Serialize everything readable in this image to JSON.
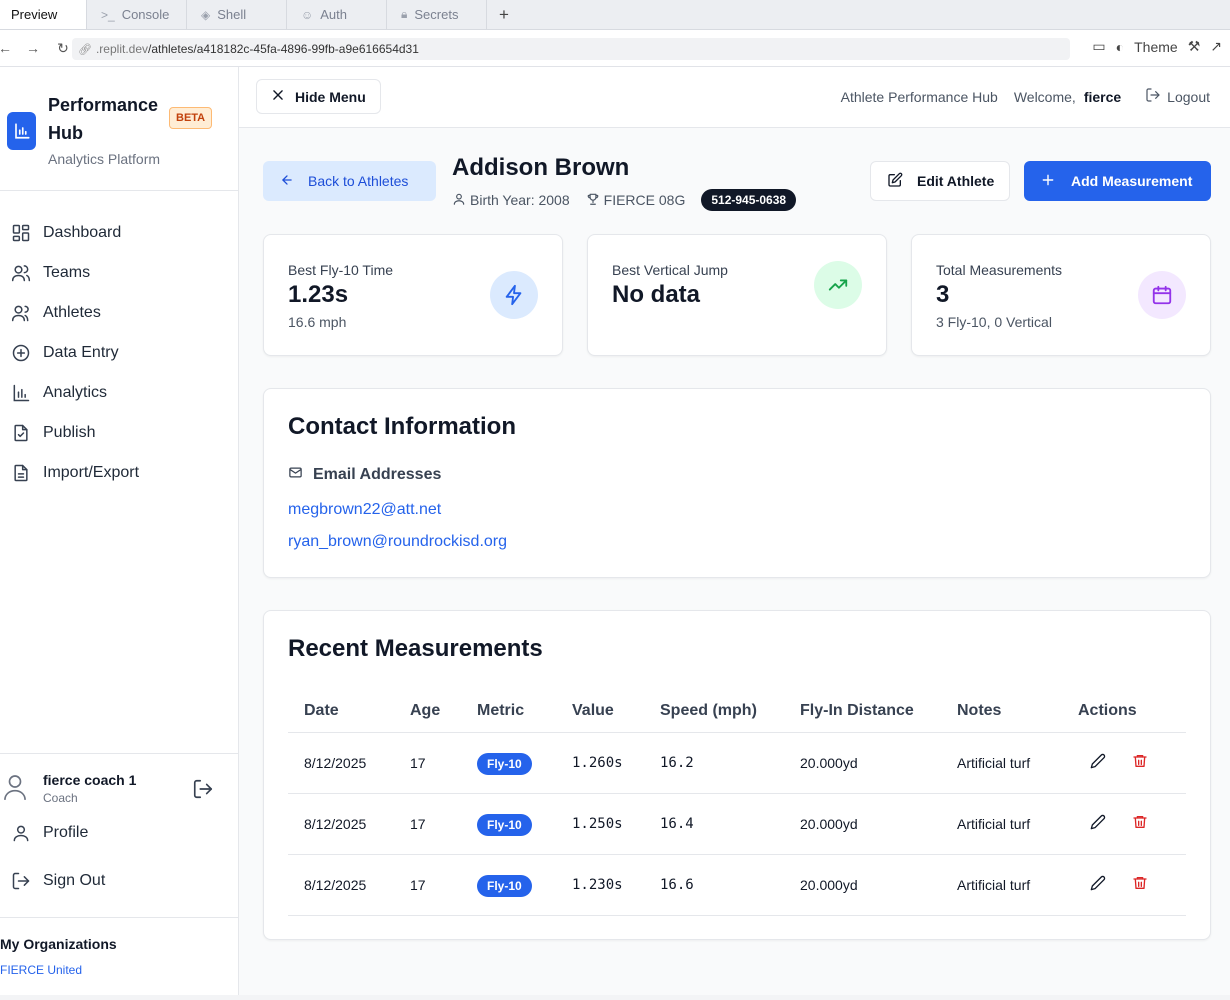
{
  "browser": {
    "tabs": [
      {
        "label": "Preview",
        "icon": "preview-icon",
        "active": true
      },
      {
        "label": "Console",
        "icon": "console-icon",
        "active": false
      },
      {
        "label": "Shell",
        "icon": "shell-icon",
        "active": false
      },
      {
        "label": "Auth",
        "icon": "auth-icon",
        "active": false
      },
      {
        "label": "Secrets",
        "icon": "lock-icon",
        "active": false
      }
    ],
    "url_dim": ".replit.dev",
    "url_path": "/athletes/a418182c-45fa-4896-99fb-a9e616654d31",
    "theme_label": "Theme"
  },
  "sidebar": {
    "brand_title": "Performance Hub",
    "brand_subtitle": "Analytics Platform",
    "beta_label": "BETA",
    "nav": [
      {
        "label": "Dashboard",
        "icon": "dashboard-icon"
      },
      {
        "label": "Teams",
        "icon": "teams-icon"
      },
      {
        "label": "Athletes",
        "icon": "athletes-icon"
      },
      {
        "label": "Data Entry",
        "icon": "plus-circle-icon"
      },
      {
        "label": "Analytics",
        "icon": "bar-chart-icon"
      },
      {
        "label": "Publish",
        "icon": "publish-icon"
      },
      {
        "label": "Import/Export",
        "icon": "file-icon"
      }
    ],
    "user_name": "fierce coach 1",
    "user_role": "Coach",
    "profile_label": "Profile",
    "signout_label": "Sign Out",
    "orgs_title": "My Organizations",
    "orgs": [
      "FIERCE United"
    ]
  },
  "header": {
    "hide_menu_label": "Hide Menu",
    "app_name": "Athlete Performance Hub",
    "welcome": "Welcome,",
    "username": "fierce",
    "logout_label": "Logout"
  },
  "athlete": {
    "back_label": "Back to Athletes",
    "name": "Addison Brown",
    "birth_year": "Birth Year: 2008",
    "team": "FIERCE 08G",
    "phone": "512-945-0638",
    "edit_label": "Edit Athlete",
    "add_label": "Add Measurement"
  },
  "stats": [
    {
      "label": "Best Fly-10 Time",
      "value": "1.23s",
      "sub": "16.6 mph",
      "icon": "lightning-icon",
      "color": "#2563eb",
      "bg": "#dbeafe"
    },
    {
      "label": "Best Vertical Jump",
      "value": "No data",
      "sub": "",
      "icon": "trending-up-icon",
      "color": "#16a34a",
      "bg": "#dcfce7"
    },
    {
      "label": "Total Measurements",
      "value": "3",
      "sub": "3 Fly-10, 0 Vertical",
      "icon": "calendar-icon",
      "color": "#9333ea",
      "bg": "#f3e8ff"
    }
  ],
  "contact": {
    "title": "Contact Information",
    "email_heading": "Email Addresses",
    "emails": [
      "megbrown22@att.net",
      "ryan_brown@roundrockisd.org"
    ]
  },
  "measurements": {
    "title": "Recent Measurements",
    "columns": [
      "Date",
      "Age",
      "Metric",
      "Value",
      "Speed (mph)",
      "Fly-In Distance",
      "Notes",
      "Actions"
    ],
    "rows": [
      {
        "date": "8/12/2025",
        "age": "17",
        "metric": "Fly-10",
        "value": "1.260s",
        "speed": "16.2",
        "distance": "20.000yd",
        "notes": "Artificial turf"
      },
      {
        "date": "8/12/2025",
        "age": "17",
        "metric": "Fly-10",
        "value": "1.250s",
        "speed": "16.4",
        "distance": "20.000yd",
        "notes": "Artificial turf"
      },
      {
        "date": "8/12/2025",
        "age": "17",
        "metric": "Fly-10",
        "value": "1.230s",
        "speed": "16.6",
        "distance": "20.000yd",
        "notes": "Artificial turf"
      }
    ]
  },
  "colors": {
    "primary": "#2563eb",
    "danger": "#dc2626"
  }
}
